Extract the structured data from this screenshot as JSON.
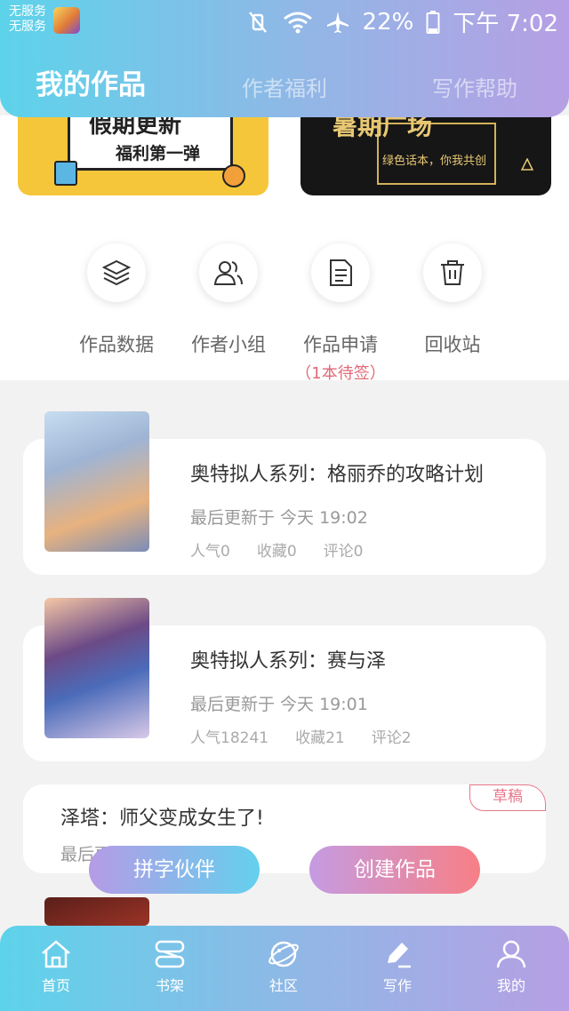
{
  "status_bar": {
    "carrier_line1": "无服务",
    "carrier_line2": "无服务",
    "battery": "22%",
    "time": "下午 7:02"
  },
  "tabs": [
    {
      "label": "我的作品",
      "active": true
    },
    {
      "label": "作者福利",
      "active": false
    },
    {
      "label": "写作帮助",
      "active": false
    }
  ],
  "banners": {
    "left": {
      "headline": "假期更新",
      "subline": "福利第一弹"
    },
    "right": {
      "headline": "暑期广场",
      "subline": "绿色话本，你我共创"
    }
  },
  "tools": [
    {
      "label": "作品数据",
      "icon": "layers-icon"
    },
    {
      "label": "作者小组",
      "icon": "group-icon"
    },
    {
      "label": "作品申请",
      "icon": "document-icon",
      "sub": "（1本待签）"
    },
    {
      "label": "回收站",
      "icon": "trash-icon"
    }
  ],
  "works": [
    {
      "title": "奥特拟人系列：格丽乔的攻略计划",
      "updated": "最后更新于 今天 19:02",
      "popularity": "人气0",
      "favorites": "收藏0",
      "comments": "评论0"
    },
    {
      "title": "奥特拟人系列：赛与泽",
      "updated": "最后更新于 今天 19:01",
      "popularity": "人气18241",
      "favorites": "收藏21",
      "comments": "评论2"
    },
    {
      "title": "泽塔：师父变成女生了!",
      "updated": "最后更新于",
      "badge": "草稿"
    }
  ],
  "actions": {
    "partner": "拼字伙伴",
    "create": "创建作品"
  },
  "bottom_nav": [
    {
      "label": "首页",
      "icon": "home-icon"
    },
    {
      "label": "书架",
      "icon": "bookshelf-icon"
    },
    {
      "label": "社区",
      "icon": "planet-icon"
    },
    {
      "label": "写作",
      "icon": "pen-icon"
    },
    {
      "label": "我的",
      "icon": "user-icon"
    }
  ],
  "colors": {
    "gradient_start": "#5dd3ea",
    "gradient_end": "#b69fe4",
    "accent_pink": "#e7778a"
  }
}
